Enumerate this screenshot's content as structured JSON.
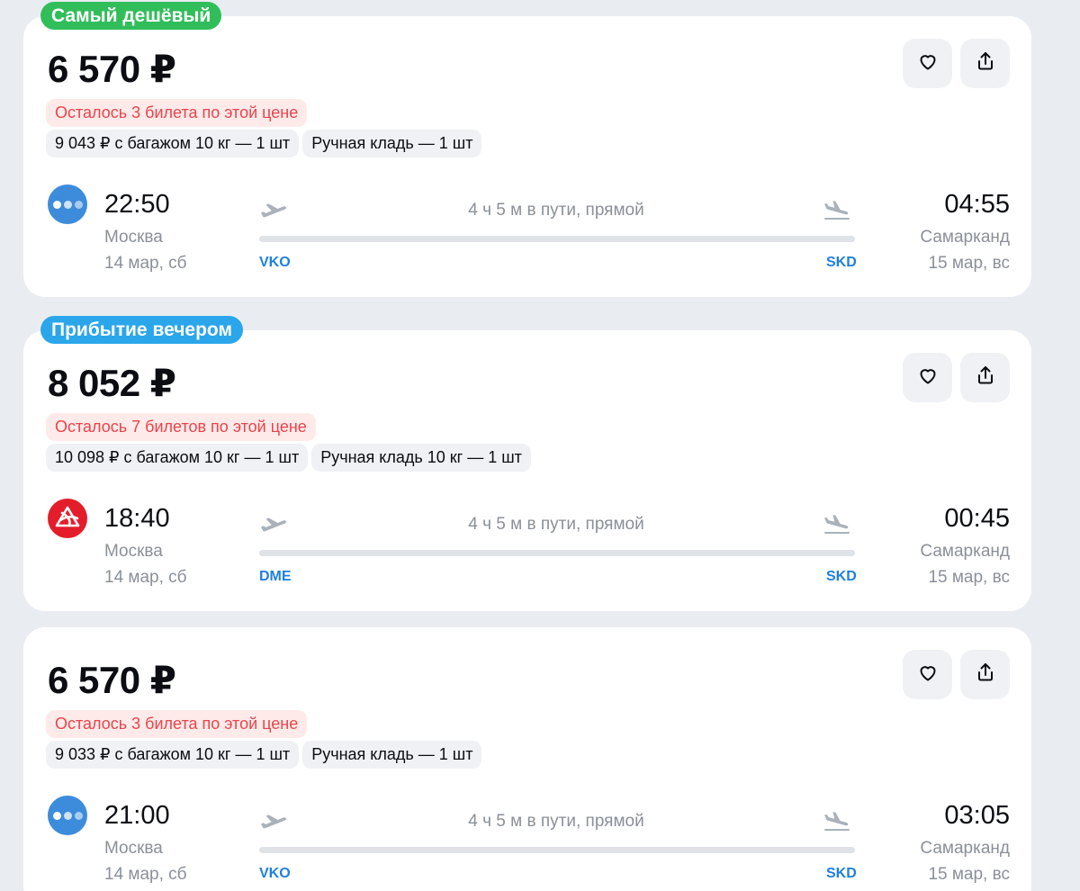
{
  "tickets": [
    {
      "badge": {
        "text": "Самый дешёвый",
        "color": "#32bd5b"
      },
      "price": "6 570 ₽",
      "warning": "Осталось 3 билета по этой цене",
      "options": [
        "9 043 ₽ с багажом 10 кг — 1 шт",
        "Ручная кладь — 1 шт"
      ],
      "airline_logo": "blue-dots",
      "departure": {
        "time": "22:50",
        "city": "Москва",
        "date": "14 мар, сб",
        "airport": "VKO"
      },
      "arrival": {
        "time": "04:55",
        "city": "Самарканд",
        "date": "15 мар, вс",
        "airport": "SKD"
      },
      "duration": "4 ч 5 м в пути, прямой"
    },
    {
      "badge": {
        "text": "Прибытие вечером",
        "color": "#2ba6ea"
      },
      "price": "8 052 ₽",
      "warning": "Осталось 7 билетов по этой цене",
      "options": [
        "10 098 ₽ с багажом 10 кг — 1 шт",
        "Ручная кладь 10 кг — 1 шт"
      ],
      "airline_logo": "red-wheel",
      "departure": {
        "time": "18:40",
        "city": "Москва",
        "date": "14 мар, сб",
        "airport": "DME"
      },
      "arrival": {
        "time": "00:45",
        "city": "Самарканд",
        "date": "15 мар, вс",
        "airport": "SKD"
      },
      "duration": "4 ч 5 м в пути, прямой"
    },
    {
      "badge": null,
      "price": "6 570 ₽",
      "warning": "Осталось 3 билета по этой цене",
      "options": [
        "9 033 ₽ с багажом 10 кг — 1 шт",
        "Ручная кладь — 1 шт"
      ],
      "airline_logo": "blue-dots",
      "departure": {
        "time": "21:00",
        "city": "Москва",
        "date": "14 мар, сб",
        "airport": "VKO"
      },
      "arrival": {
        "time": "03:05",
        "city": "Самарканд",
        "date": "15 мар, вс",
        "airport": "SKD"
      },
      "duration": "4 ч 5 м в пути, прямой"
    }
  ],
  "icons": {
    "favorite": "heart-icon",
    "share": "share-icon",
    "departure": "plane-takeoff-icon",
    "arrival": "plane-landing-icon"
  }
}
